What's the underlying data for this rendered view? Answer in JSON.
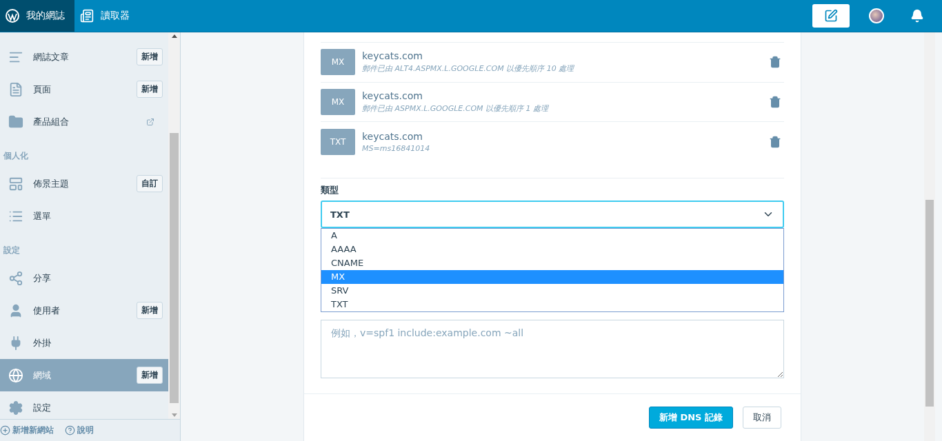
{
  "masterbar": {
    "my_site": "我的網誌",
    "reader": "讀取器"
  },
  "sidebar": {
    "sections": [
      {
        "items": [
          {
            "label": "網誌文章",
            "action": "新增",
            "kind": "button",
            "selected": false
          },
          {
            "label": "頁面",
            "action": "新增",
            "kind": "button",
            "selected": false
          },
          {
            "label": "產品組合",
            "kind": "external",
            "selected": false
          }
        ]
      },
      {
        "heading": "個人化",
        "items": [
          {
            "label": "佈景主題",
            "action": "自訂",
            "kind": "button",
            "selected": false
          },
          {
            "label": "選單",
            "kind": "plain",
            "selected": false
          }
        ]
      },
      {
        "heading": "設定",
        "items": [
          {
            "label": "分享",
            "kind": "plain",
            "selected": false
          },
          {
            "label": "使用者",
            "action": "新增",
            "kind": "button",
            "selected": false
          },
          {
            "label": "外掛",
            "kind": "plain",
            "selected": false
          },
          {
            "label": "網域",
            "action": "新增",
            "kind": "button",
            "selected": true
          },
          {
            "label": "設定",
            "kind": "plain",
            "selected": false
          }
        ]
      }
    ],
    "footer": [
      "新增新網站",
      "說明"
    ]
  },
  "records": [
    {
      "type": "MX",
      "name": "keycats.com",
      "detail": "郵件已由 ALT4.ASPMX.L.GOOGLE.COM 以優先順序 10 處理"
    },
    {
      "type": "MX",
      "name": "keycats.com",
      "detail": "郵件已由 ASPMX.L.GOOGLE.COM 以優先順序 1 處理"
    },
    {
      "type": "TXT",
      "name": "keycats.com",
      "detail": "MS=ms16841014"
    }
  ],
  "form": {
    "type_label": "類型",
    "type_value": "TXT",
    "options": [
      {
        "label": "A",
        "selected": false
      },
      {
        "label": "AAAA",
        "selected": false
      },
      {
        "label": "CNAME",
        "selected": false
      },
      {
        "label": "MX",
        "selected": true
      },
      {
        "label": "SRV",
        "selected": false
      },
      {
        "label": "TXT",
        "selected": false
      }
    ],
    "text_placeholder": "例如，v=spf1 include:example.com ~all",
    "buttons": {
      "submit": "新增 DNS 記錄",
      "cancel": "取消"
    }
  }
}
